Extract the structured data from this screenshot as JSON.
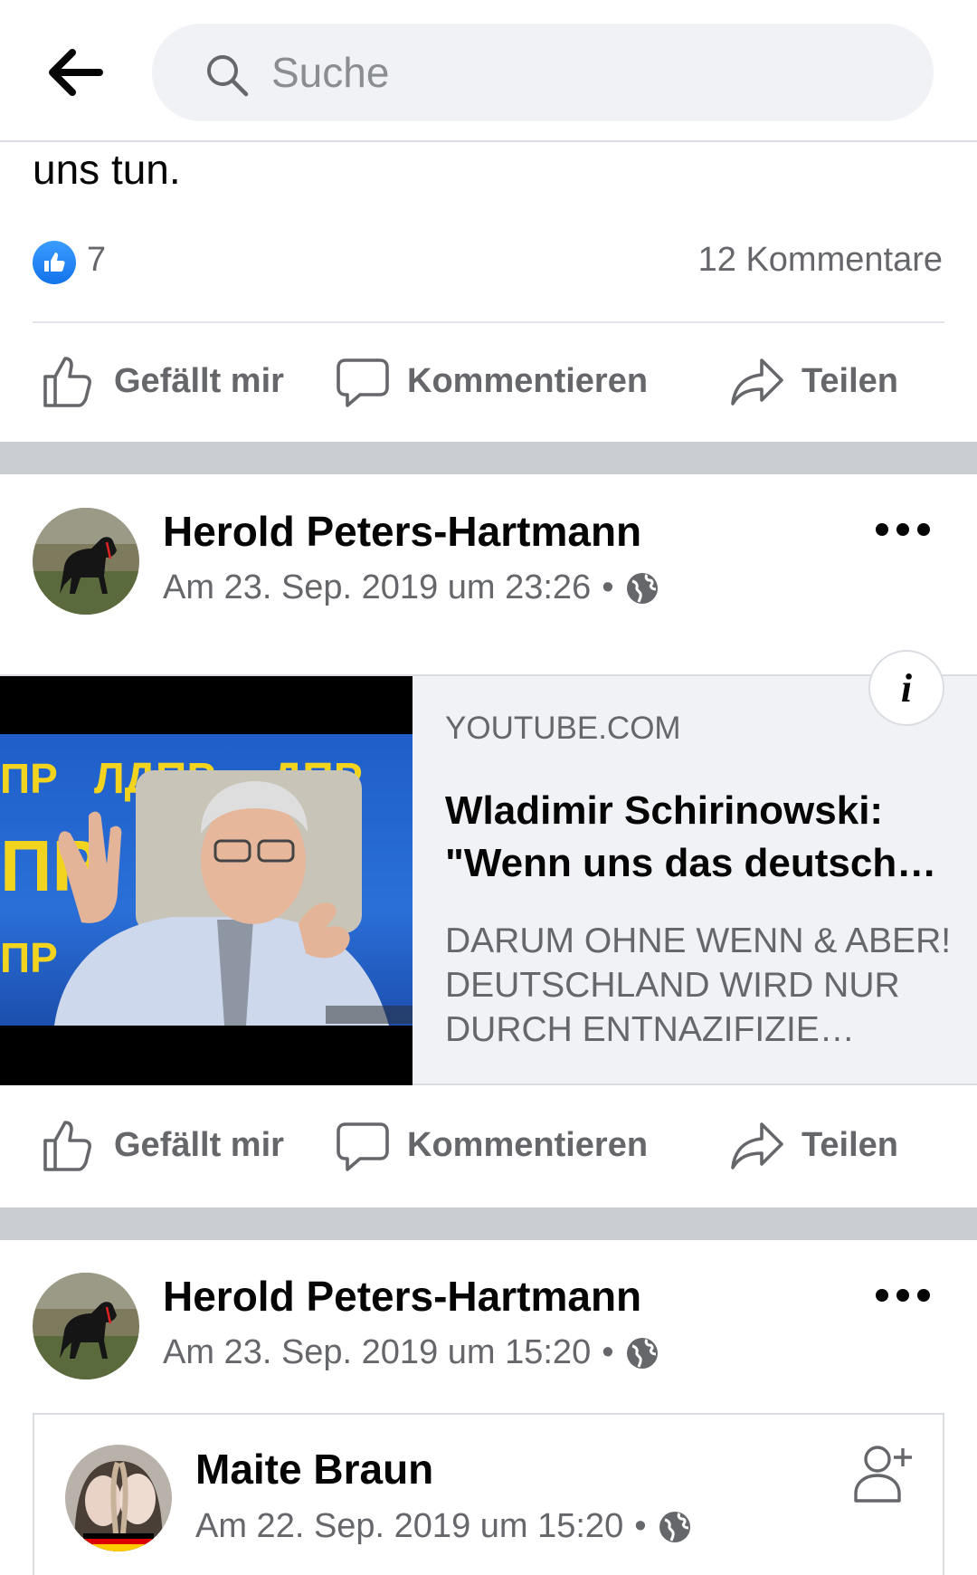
{
  "search": {
    "placeholder": "Suche"
  },
  "post1": {
    "text_tail": "uns tun.",
    "like_count": "7",
    "comment_count": "12 Kommentare",
    "actions": {
      "like": "Gefällt mir",
      "comment": "Kommentieren",
      "share": "Teilen"
    }
  },
  "post2": {
    "author": "Herold Peters-Hartmann",
    "timestamp": "Am 23. Sep. 2019 um 23:26",
    "separator": "•",
    "link": {
      "domain": "YOUTUBE.COM",
      "title": "Wladimir Schirinowski: \"Wenn uns das deutsch…",
      "description": "DARUM OHNE WENN & ABER! DEUTSCHLAND WIRD NUR DURCH ENTNAZIFIZIE…",
      "thumbnail_text": [
        "ЛДПР",
        "ДПР",
        "ПР",
        "ПР",
        "ПР",
        "ПР"
      ],
      "info_glyph": "i"
    },
    "actions": {
      "like": "Gefällt mir",
      "comment": "Kommentieren",
      "share": "Teilen"
    }
  },
  "post3": {
    "author": "Herold Peters-Hartmann",
    "timestamp": "Am 23. Sep. 2019 um 15:20",
    "separator": "•",
    "shared": {
      "author": "Maite Braun",
      "timestamp": "Am 22. Sep. 2019 um 15:20",
      "separator": "•"
    }
  },
  "colors": {
    "accent": "#1877f2",
    "secondary_text": "#65676b",
    "separator": "#c9ccd1"
  }
}
